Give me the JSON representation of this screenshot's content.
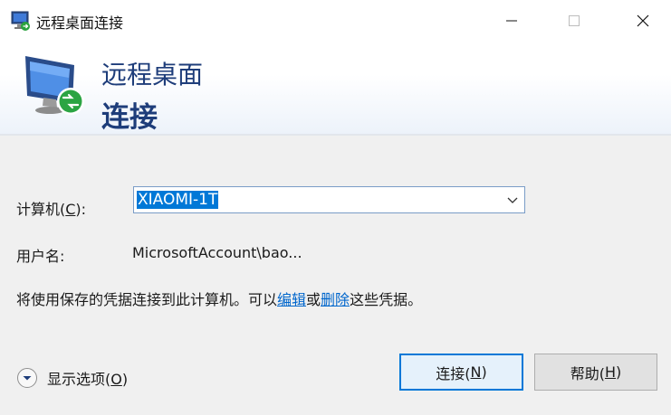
{
  "window": {
    "title": "远程桌面连接",
    "controls": [
      "minimize",
      "maximize",
      "close"
    ]
  },
  "banner": {
    "line1": "远程桌面",
    "line2": "连接",
    "icon": "remote-desktop-monitor-icon"
  },
  "form": {
    "computer_label_pre": "计算机(",
    "computer_label_key": "C",
    "computer_label_post": "):",
    "computer_value": "XIAOMI-1T",
    "username_label": "用户名:",
    "username_value": "MicrosoftAccount\\bao..."
  },
  "info": {
    "text_before": "将使用保存的凭据连接到此计算机。可以",
    "edit_link": "编辑",
    "text_or": "或",
    "delete_link": "删除",
    "text_after": "这些凭据。"
  },
  "options": {
    "label_pre": "显示选项(",
    "label_key": "O",
    "label_post": ")"
  },
  "buttons": {
    "connect_pre": "连接(",
    "connect_key": "N",
    "connect_post": ")",
    "help_pre": "帮助(",
    "help_key": "H",
    "help_post": ")"
  },
  "colors": {
    "accent": "#0078d7",
    "banner_text": "#1e3d7a",
    "link": "#0066cc"
  }
}
